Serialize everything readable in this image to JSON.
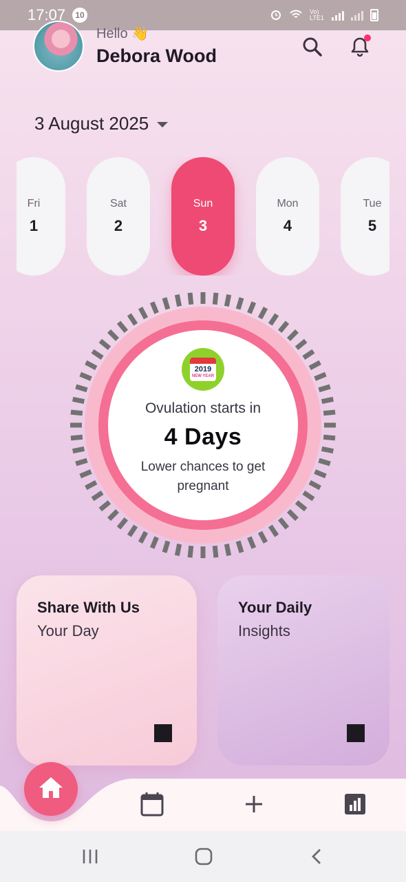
{
  "status_bar": {
    "time": "17:07",
    "notification_count": "10",
    "network_label": "Vo) LTE1"
  },
  "header": {
    "greeting": "Hello 👋",
    "user_name": "Debora Wood"
  },
  "date_selector": {
    "label": "3 August 2025"
  },
  "days": [
    {
      "name": "Fri",
      "number": "1",
      "selected": false
    },
    {
      "name": "Sat",
      "number": "2",
      "selected": false
    },
    {
      "name": "Sun",
      "number": "3",
      "selected": true
    },
    {
      "name": "Mon",
      "number": "4",
      "selected": false
    },
    {
      "name": "Tue",
      "number": "5",
      "selected": false
    }
  ],
  "ovulation": {
    "title": "Ovulation starts in",
    "value": "4 Days",
    "subtitle": "Lower chances to get pregnant",
    "badge_year": "2019",
    "badge_text": "NEW YEAR"
  },
  "cards": [
    {
      "title": "Share With Us",
      "subtitle": "Your Day"
    },
    {
      "title": "Your Daily",
      "subtitle": "Insights"
    }
  ],
  "nav": {
    "items": [
      "home-icon",
      "calendar-icon",
      "plus-icon",
      "bar-chart-icon"
    ]
  },
  "colors": {
    "accent": "#ee4a73",
    "fab": "#f05b80",
    "ring_outer": "#f9b9cc",
    "ring_inner": "#f46f93",
    "ticks": "#727272"
  }
}
